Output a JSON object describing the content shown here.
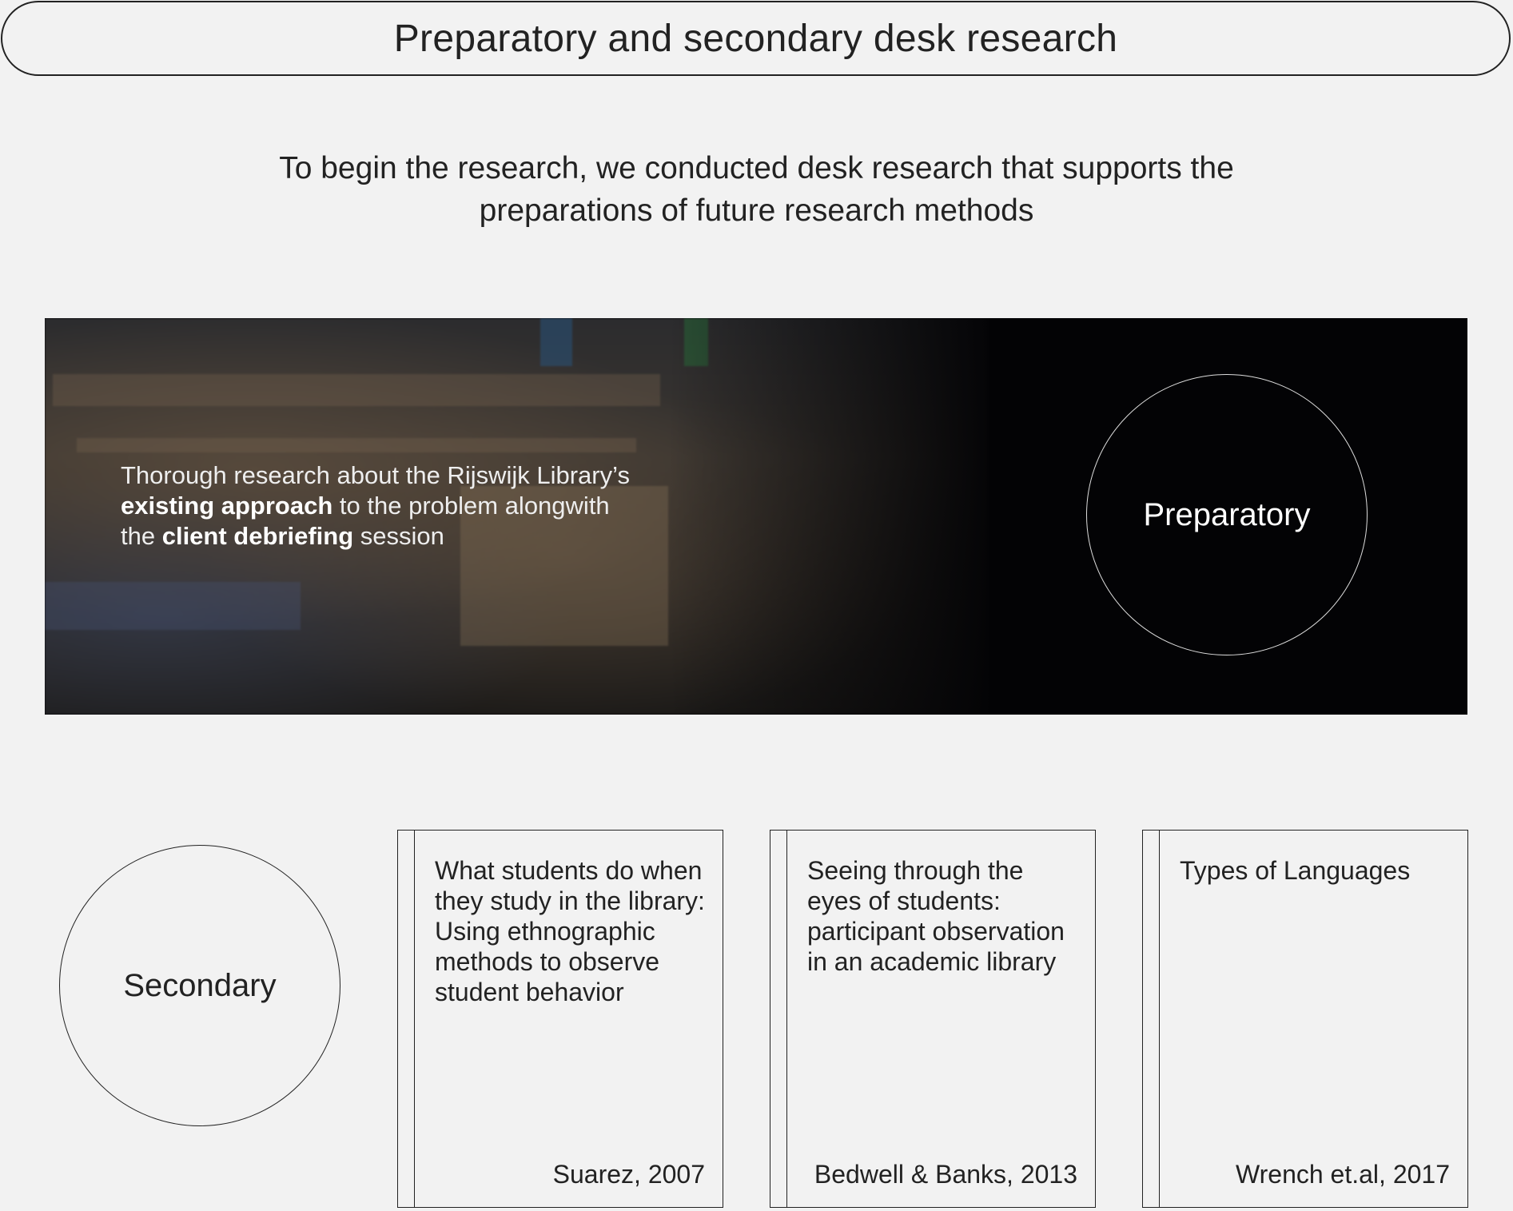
{
  "header": {
    "title": "Preparatory and secondary desk research"
  },
  "intro": {
    "line1": "To begin the research, we conducted desk research that supports the",
    "line2": "preparations of future research methods"
  },
  "preparatory": {
    "label": "Preparatory",
    "text": {
      "part1": "Thorough research about the Rijswijk Library’s ",
      "bold1": "existing approach",
      "part2": " to the problem alongwith the ",
      "bold2": "client debriefing",
      "part3": " session"
    }
  },
  "secondary": {
    "label": "Secondary",
    "sources": [
      {
        "title": "What students do when they study in the library: Using ethnographic methods to observe student behavior",
        "author": "Suarez, 2007"
      },
      {
        "title": "Seeing through the eyes of students: participant observation in an academic library",
        "author": "Bedwell & Banks, 2013"
      },
      {
        "title": "Types of Languages",
        "author": "Wrench et.al, 2017"
      }
    ]
  }
}
